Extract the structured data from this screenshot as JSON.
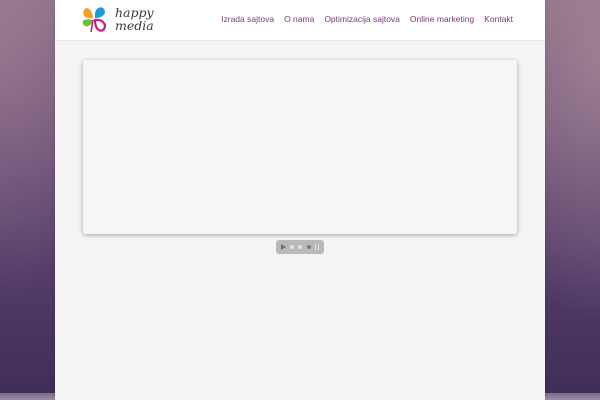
{
  "brand": {
    "line1": "happy",
    "line2": "media",
    "logo_icon": "clover-logo-icon",
    "colors": {
      "orange": "#f4a11d",
      "blue": "#1e9ad6",
      "green": "#6cbf3c",
      "magenta": "#c5207f"
    }
  },
  "nav": {
    "items": [
      {
        "label": "Izrada sajtova"
      },
      {
        "label": "O nama"
      },
      {
        "label": "Optimizacija sajtova"
      },
      {
        "label": "Online marketing"
      },
      {
        "label": "Kontakt"
      }
    ],
    "color": "#7b3a78"
  },
  "slider": {
    "controls": {
      "play_icon": "play-icon",
      "dot_icon": "slide-dot-icon",
      "pause_icon": "pause-icon",
      "slides": 3,
      "active_slide": 3
    }
  }
}
